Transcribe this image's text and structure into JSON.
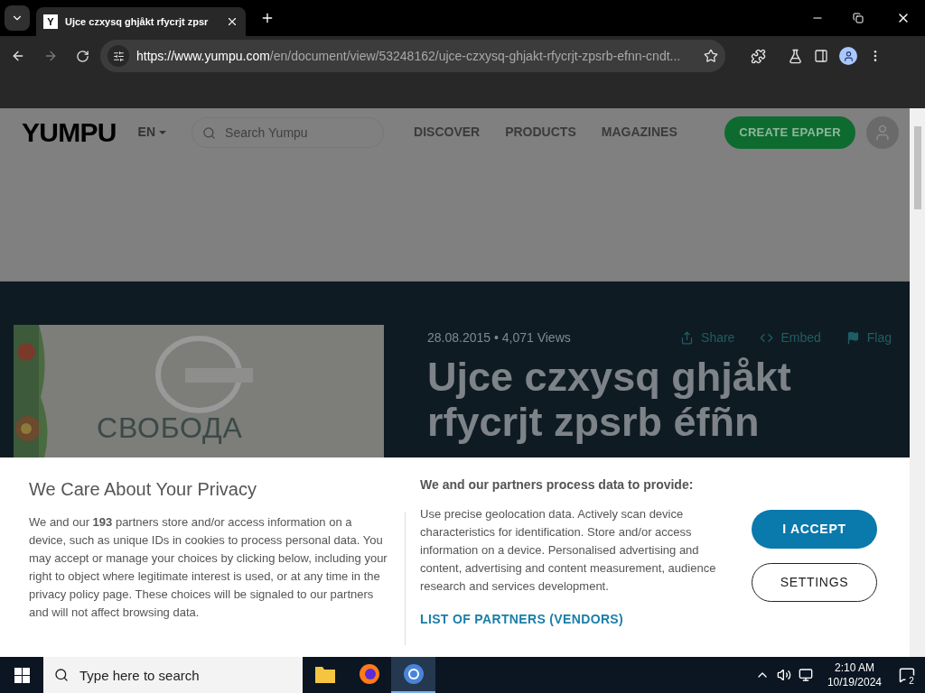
{
  "browser": {
    "favicon": "Y",
    "tab_title": "Ujce czxysq ghjåkt rfycrjt zpsr",
    "url_host": "https://www.yumpu.com",
    "url_path": "/en/document/view/53248162/ujce-czxysq-ghjakt-rfycrjt-zpsrb-efnn-cndt..."
  },
  "header": {
    "logo": "YUMPU",
    "language": "EN",
    "search": {
      "placeholder": "Search Yumpu"
    },
    "nav": [
      "DISCOVER",
      "PRODUCTS",
      "MAGAZINES"
    ],
    "cta": "CREATE EPAPER"
  },
  "document": {
    "cover_text": "СВОБОДА",
    "meta": "28.08.2015 • 4,071 Views",
    "actions": [
      {
        "kind": "share",
        "label": "Share"
      },
      {
        "kind": "embed",
        "label": "Embed"
      },
      {
        "kind": "flag",
        "label": "Flag"
      }
    ],
    "title": "Ujce czxysq ghjåkt rfycrjt zpsrb éfñn"
  },
  "consent": {
    "heading": "We Care About Your Privacy",
    "body": "We and our **193** partners store and/or access information on a device, such as unique IDs in cookies to process personal data. You may accept or manage your choices by clicking below, including your right to object where legitimate interest is used, or at any time in the privacy policy page. These choices will be signaled to our partners and will not affect browsing data.",
    "purposes_heading": "We and our partners process data to provide:",
    "purposes": "Use precise geolocation data. Actively scan device characteristics for identification. Store and/or access information on a device. Personalised advertising and content, advertising and content measurement, audience research and services development.",
    "partners_link": "LIST OF PARTNERS (VENDORS)",
    "accept": "I ACCEPT",
    "settings": "SETTINGS"
  },
  "taskbar": {
    "search_placeholder": "Type here to search",
    "apps": [
      {
        "kind": "files",
        "selected": false
      },
      {
        "kind": "firefox",
        "selected": false
      },
      {
        "kind": "chrome",
        "selected": true
      }
    ],
    "time": "2:10 AM",
    "date": "10/19/2024",
    "notifications": "2"
  }
}
